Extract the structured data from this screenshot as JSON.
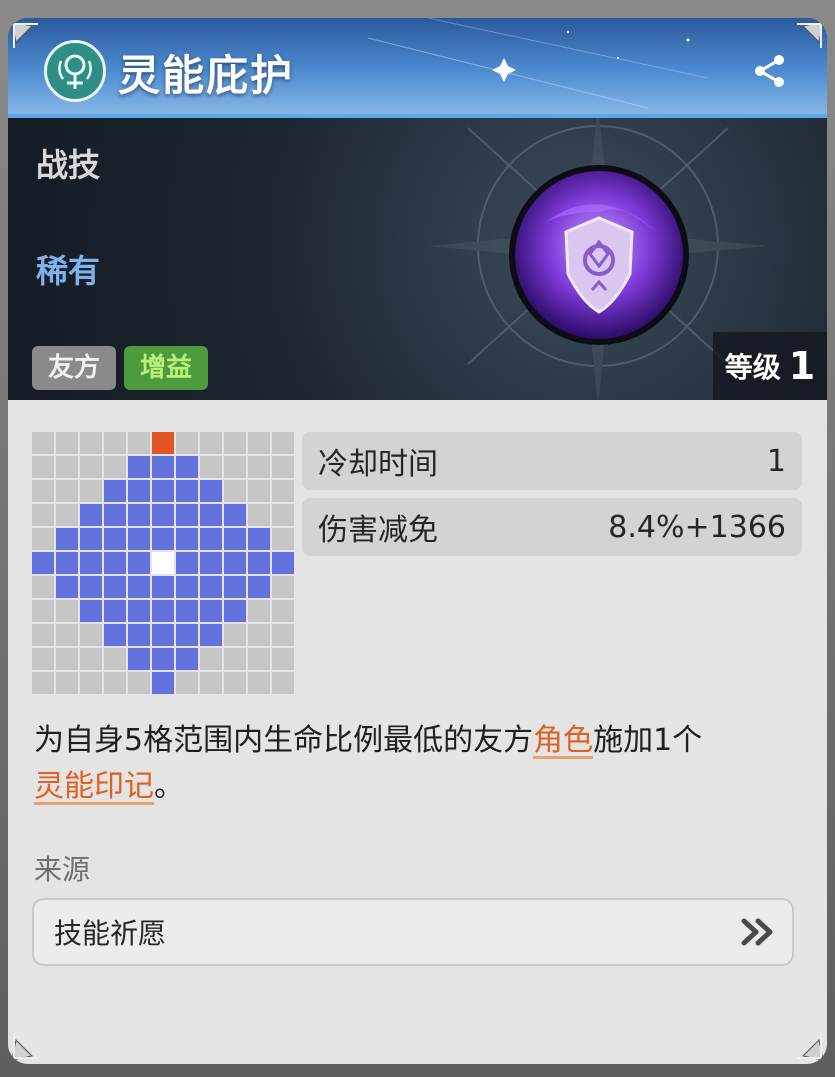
{
  "header": {
    "title": "灵能庇护",
    "share_icon": "share-icon",
    "logo_icon": "element-emblem-icon"
  },
  "banner": {
    "skill_type": "战技",
    "rarity": "稀有",
    "tags": [
      "友方",
      "增益"
    ],
    "level_label": "等级",
    "level_value": "1",
    "orb_icon": "psionic-shield-orb-icon"
  },
  "range_grid": {
    "size": 11,
    "origin": [
      0,
      5
    ],
    "self": [
      5,
      5
    ],
    "range": [
      [
        1,
        4
      ],
      [
        1,
        5
      ],
      [
        1,
        6
      ],
      [
        2,
        3
      ],
      [
        2,
        4
      ],
      [
        2,
        5
      ],
      [
        2,
        6
      ],
      [
        2,
        7
      ],
      [
        3,
        2
      ],
      [
        3,
        3
      ],
      [
        3,
        4
      ],
      [
        3,
        5
      ],
      [
        3,
        6
      ],
      [
        3,
        7
      ],
      [
        3,
        8
      ],
      [
        4,
        1
      ],
      [
        4,
        2
      ],
      [
        4,
        3
      ],
      [
        4,
        4
      ],
      [
        4,
        5
      ],
      [
        4,
        6
      ],
      [
        4,
        7
      ],
      [
        4,
        8
      ],
      [
        4,
        9
      ],
      [
        5,
        0
      ],
      [
        5,
        1
      ],
      [
        5,
        2
      ],
      [
        5,
        3
      ],
      [
        5,
        4
      ],
      [
        5,
        6
      ],
      [
        5,
        7
      ],
      [
        5,
        8
      ],
      [
        5,
        9
      ],
      [
        5,
        10
      ],
      [
        6,
        1
      ],
      [
        6,
        2
      ],
      [
        6,
        3
      ],
      [
        6,
        4
      ],
      [
        6,
        5
      ],
      [
        6,
        6
      ],
      [
        6,
        7
      ],
      [
        6,
        8
      ],
      [
        6,
        9
      ],
      [
        7,
        2
      ],
      [
        7,
        3
      ],
      [
        7,
        4
      ],
      [
        7,
        5
      ],
      [
        7,
        6
      ],
      [
        7,
        7
      ],
      [
        7,
        8
      ],
      [
        8,
        3
      ],
      [
        8,
        4
      ],
      [
        8,
        5
      ],
      [
        8,
        6
      ],
      [
        8,
        7
      ],
      [
        9,
        4
      ],
      [
        9,
        5
      ],
      [
        9,
        6
      ],
      [
        10,
        5
      ]
    ],
    "colors": {
      "range": "#6272dc",
      "origin": "#e25424",
      "self": "#ffffff",
      "empty": "#c6c6c6"
    }
  },
  "stats": [
    {
      "label": "冷却时间",
      "value": "1"
    },
    {
      "label": "伤害减免",
      "value": "8.4%+1366"
    }
  ],
  "description": {
    "part1": "为自身5格范围内生命比例最低的友方",
    "keyword1": "角色",
    "part2": "施加1个",
    "keyword2": "灵能印记",
    "part3": "。"
  },
  "source": {
    "label": "来源",
    "item": "技能祈愿",
    "arrow_icon": "double-chevron-right-icon"
  },
  "colors": {
    "keyword": "#e06020",
    "rarity": "#7fb2ea",
    "buff_tag_bg": "#4e9a3e",
    "buff_tag_text": "#b8f07a"
  }
}
